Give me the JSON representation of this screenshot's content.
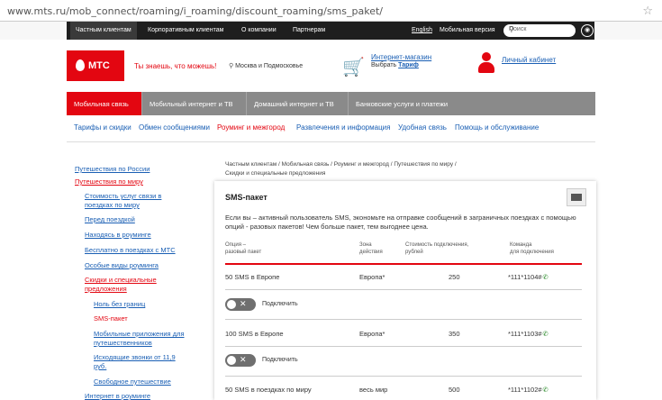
{
  "browser": {
    "url": "www.mts.ru/mob_connect/roaming/i_roaming/discount_roaming/sms_paket/"
  },
  "topnav": {
    "items": [
      "Частным клиентам",
      "Корпоративным клиентам",
      "О компании",
      "Партнерам",
      "English",
      "Мобильная версия"
    ],
    "search_placeholder": "Поиск"
  },
  "header": {
    "logo": "МТС",
    "slogan": "Ты знаешь, что можешь!",
    "region": "Москва и Подмосковье",
    "shop_link": "Интернет-магазин",
    "shop_choose": "Выбрать",
    "shop_tariff": "Тариф",
    "cabinet": "Личный кабинет"
  },
  "mainnav": [
    "Мобильная связь",
    "Мобильный интернет и ТВ",
    "Домашний интернет и ТВ",
    "Банковские услуги и платежи"
  ],
  "subnav": [
    "Тарифы и скидки",
    "Обмен сообщениями",
    "Роуминг и межгород",
    "Развлечения и информация",
    "Удобная связь",
    "Помощь и обслуживание"
  ],
  "sidebar": {
    "items": [
      "Путешествия по России",
      "Путешествия по миру",
      "Стоимость услуг связи в",
      "поездках по миру",
      "Перед поездкой",
      "Находясь в роуминге",
      "Бесплатно в поездках с МТС",
      "Особые виды роуминга",
      "Скидки и специальные",
      "предложения",
      "Ноль без границ",
      "SMS-пакет",
      "Мобильные приложения для",
      "путешественников",
      "Исходящие звонки от 11,9",
      "руб.",
      "Свободное путешествие",
      "Интернет в роуминге"
    ]
  },
  "breadcrumbs": {
    "line1": "Частным клиентам / Мобильная связь / Роуминг и межгород / Путешествия по миру /",
    "line2": "Скидки и специальные предложения"
  },
  "content": {
    "title": "SMS-пакет",
    "intro": "Если вы – активный пользователь SMS, экономьте на отправке сообщений в заграничных поездках с помощью опций - разовых пакетов! Чем больше пакет, тем выгоднее цена.",
    "headers": {
      "option_l1": "Опция –",
      "option_l2": "разовый пакет",
      "zone_l1": "Зона",
      "zone_l2": "действия",
      "cost_l1": "Стоимость подключения,",
      "cost_l2": "рублей",
      "cmd_l1": "Команда",
      "cmd_l2": "для подключения"
    },
    "rows": [
      {
        "option": "50 SMS в Европе",
        "zone": "Европа*",
        "cost": "250",
        "command": "*111*1104#"
      },
      {
        "option": "100 SMS в Европе",
        "zone": "Европа*",
        "cost": "350",
        "command": "*111*1103#"
      },
      {
        "option": "50 SMS в поездках по миру",
        "zone": "весь мир",
        "cost": "500",
        "command": "*111*1102#"
      }
    ],
    "connect_label": "Подключить"
  }
}
